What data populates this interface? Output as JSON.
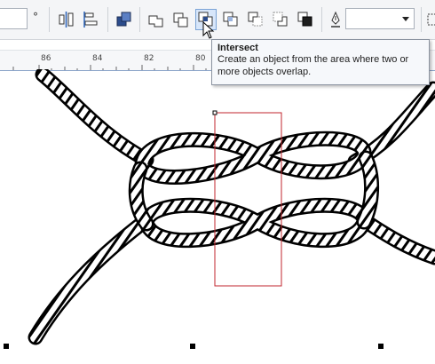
{
  "toolbar": {
    "degree_symbol": "°",
    "active_tool": "intersect"
  },
  "ruler": {
    "labels": [
      "86",
      "84",
      "82",
      "80"
    ]
  },
  "tooltip": {
    "title": "Intersect",
    "body_line1": "Create an object from the area where two or",
    "body_line2": "more objects overlap."
  },
  "colors": {
    "selection_rect": "#c0262d",
    "active_button_bg": "#d7e6fa",
    "ruler_border": "#8ba4c9"
  }
}
